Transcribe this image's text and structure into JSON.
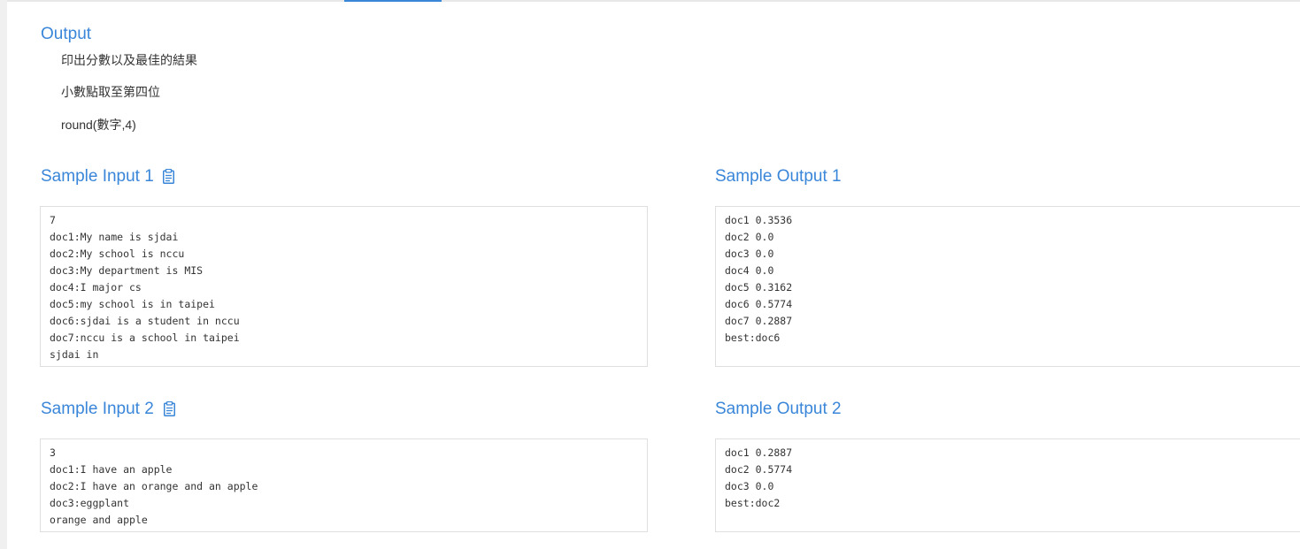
{
  "output_section": {
    "title": "Output",
    "lines": [
      "印出分數以及最佳的結果",
      "小數點取至第四位",
      "round(數字,4)"
    ]
  },
  "samples": [
    {
      "input_title": "Sample Input 1",
      "output_title": "Sample Output 1",
      "input_text": "7\ndoc1:My name is sjdai\ndoc2:My school is nccu\ndoc3:My department is MIS\ndoc4:I major cs\ndoc5:my school is in taipei\ndoc6:sjdai is a student in nccu\ndoc7:nccu is a school in taipei\nsjdai in",
      "output_text": "doc1 0.3536\ndoc2 0.0\ndoc3 0.0\ndoc4 0.0\ndoc5 0.3162\ndoc6 0.5774\ndoc7 0.2887\nbest:doc6"
    },
    {
      "input_title": "Sample Input 2",
      "output_title": "Sample Output 2",
      "input_text": "3\ndoc1:I have an apple\ndoc2:I have an orange and an apple\ndoc3:eggplant\norange and apple",
      "output_text": "doc1 0.2887\ndoc2 0.5774\ndoc3 0.0\nbest:doc2"
    }
  ],
  "icons": {
    "copy": "clipboard-icon"
  },
  "colors": {
    "accent": "#3a86d9",
    "text": "#333333",
    "box_border": "#dfdfdf"
  }
}
